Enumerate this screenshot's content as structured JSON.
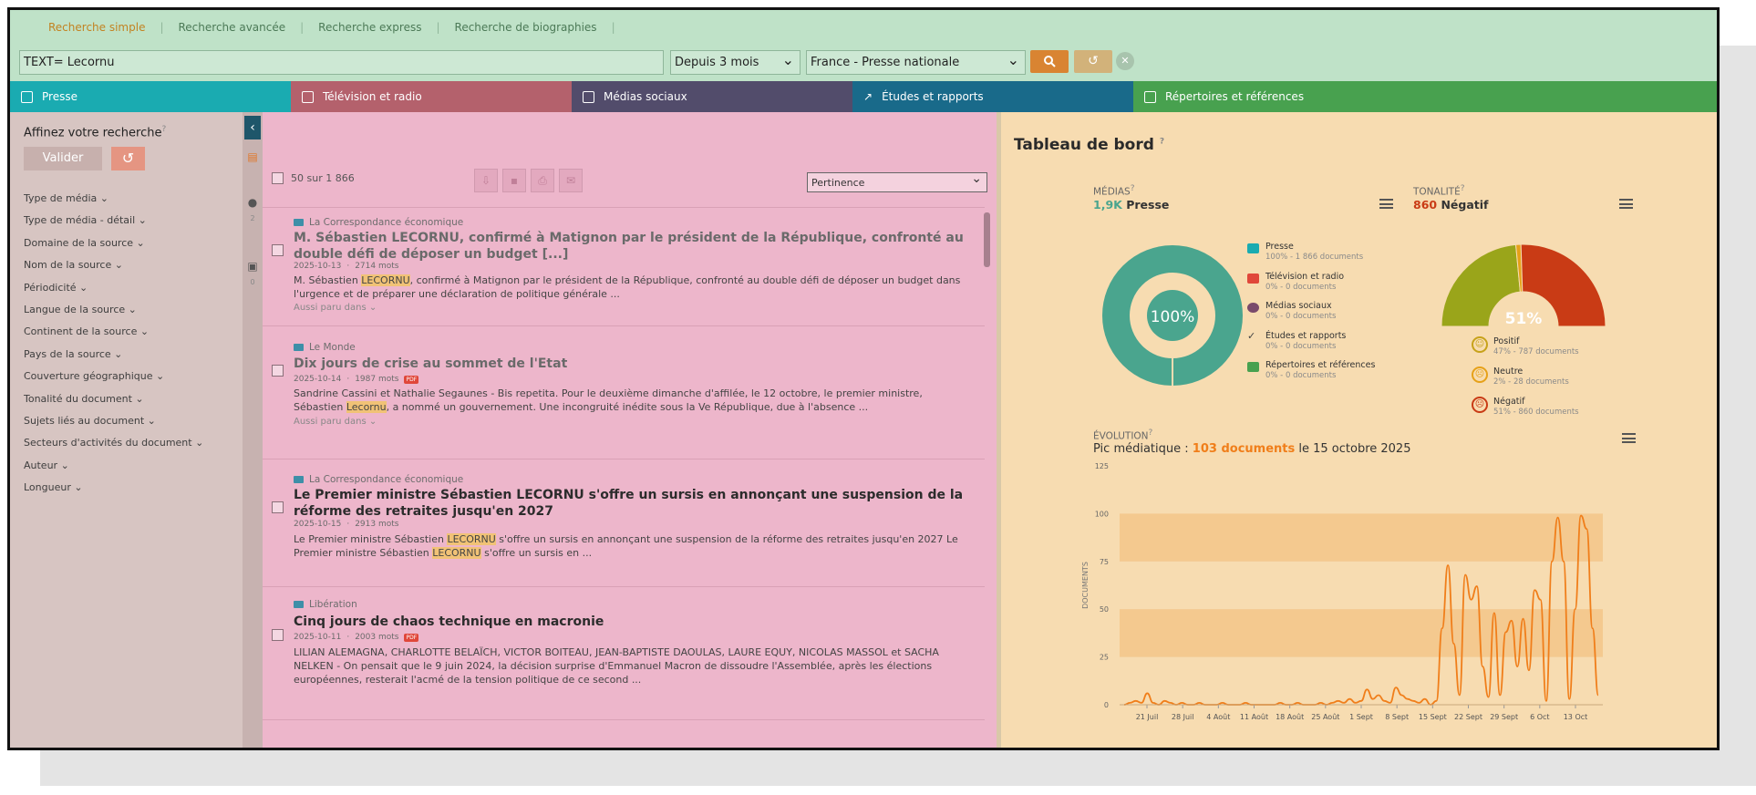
{
  "search_tabs": [
    "Recherche simple",
    "Recherche avancée",
    "Recherche express",
    "Recherche de biographies"
  ],
  "search": {
    "query": "TEXT= Lecornu",
    "period": "Depuis 3 mois",
    "scope": "France - Presse nationale"
  },
  "media_bar": [
    {
      "label": "Presse",
      "color": "#1aabb1"
    },
    {
      "label": "Télévision et radio",
      "color": "#b4616c"
    },
    {
      "label": "Médias sociaux",
      "color": "#524c6b"
    },
    {
      "label": "Études et rapports",
      "color": "#196a8a"
    },
    {
      "label": "Répertoires et références",
      "color": "#48a14f"
    }
  ],
  "sidebar": {
    "title": "Affinez votre recherche",
    "validate_label": "Valider",
    "facets": [
      "Type de média",
      "Type de média - détail",
      "Domaine de la source",
      "Nom de la source",
      "Périodicité",
      "Langue de la source",
      "Continent de la source",
      "Pays de la source",
      "Couverture géographique",
      "Tonalité du document",
      "Sujets liés au document",
      "Secteurs d'activités du document",
      "Auteur",
      "Longueur"
    ],
    "strip_counts": [
      "2",
      "0"
    ]
  },
  "results": {
    "count": "50 sur 1 866",
    "sort": "Pertinence",
    "also_label": "Aussi paru dans",
    "articles": [
      {
        "source": "La Correspondance économique",
        "title": "M. Sébastien LECORNU, confirmé à Matignon par le président de la République, confronté au double défi de déposer un budget [...]",
        "date": "2025-10-13",
        "words": "2714 mots",
        "pdf": false,
        "body_pre": "M. Sébastien ",
        "body_hl": "LECORNU",
        "body_post": ", confirmé à Matignon par le président de la République, confronté au double défi de déposer un budget dans l'urgence et de préparer une déclaration de politique générale ..."
      },
      {
        "source": "Le Monde",
        "title": "Dix jours de crise au sommet de l'Etat",
        "date": "2025-10-14",
        "words": "1987 mots",
        "pdf": true,
        "pdf_label": "PDF",
        "body_pre": "Sandrine Cassini et Nathalie Segaunes - Bis repetita. Pour le deuxième dimanche d'affilée, le 12 octobre, le premier ministre, Sébastien ",
        "body_hl": "Lecornu",
        "body_post": ", a nommé un gouvernement. Une incongruité inédite sous la Ve République, due à l'absence ..."
      },
      {
        "source": "La Correspondance économique",
        "title": "Le Premier ministre Sébastien LECORNU s'offre un sursis en annonçant une suspension de la réforme des retraites jusqu'en 2027",
        "date": "2025-10-15",
        "words": "2913 mots",
        "pdf": false,
        "body_pre": "Le Premier ministre Sébastien ",
        "body_hl": "LECORNU",
        "body_mid": " s'offre un sursis en annonçant une suspension de la réforme des retraites jusqu'en 2027 Le Premier ministre Sébastien ",
        "body_hl2": "LECORNU",
        "body_post": " s'offre un sursis en ..."
      },
      {
        "source": "Libération",
        "title": "Cinq jours de chaos technique en macronie",
        "date": "2025-10-11",
        "words": "2003 mots",
        "pdf": true,
        "pdf_label": "PDF",
        "body_pre": "LILIAN ALEMAGNA, CHARLOTTE BELAÏCH, VICTOR BOITEAU, JEAN-BAPTISTE DAOULAS, LAURE EQUY, NICOLAS MASSOL et SACHA NELKEN - On pensait que le 9 juin 2024, la décision surprise d'Emmanuel Macron de dissoudre l'Assemblée, après les élections européennes, resterait l'acmé de la tension politique de ce second ..."
      }
    ]
  },
  "dashboard": {
    "title": "Tableau de bord",
    "medias": {
      "label": "MÉDIAS",
      "kpi_value": "1,9K",
      "kpi_label": "Presse",
      "center": "100%",
      "legend": [
        {
          "name": "Presse",
          "detail": "100% - 1 866 documents",
          "color": "#1aabb1"
        },
        {
          "name": "Télévision et radio",
          "detail": "0% - 0 documents",
          "color": "#e0473a"
        },
        {
          "name": "Médias sociaux",
          "detail": "0% - 0 documents",
          "color": "#7a4a6b"
        },
        {
          "name": "Études et rapports",
          "detail": "0% - 0 documents",
          "color": "#555"
        },
        {
          "name": "Répertoires et références",
          "detail": "0% - 0 documents",
          "color": "#48a14f"
        }
      ]
    },
    "tonalite": {
      "label": "TONALITÉ",
      "kpi_value": "860",
      "kpi_label": "Négatif",
      "center": "51%",
      "shares": {
        "positif": 47,
        "neutre": 2,
        "negatif": 51
      },
      "legend": [
        {
          "name": "Positif",
          "detail": "47% - 787 documents",
          "color": "#9aa51a",
          "face": "☺"
        },
        {
          "name": "Neutre",
          "detail": "2% - 28 documents",
          "color": "#e6a118",
          "face": "☹"
        },
        {
          "name": "Négatif",
          "detail": "51% - 860 documents",
          "color": "#c93b15",
          "face": "☹"
        }
      ]
    },
    "evolution": {
      "label": "ÉVOLUTION",
      "peak_prefix": "Pic médiatique :",
      "peak_value": "103 documents",
      "peak_suffix": "le 15 octobre 2025"
    }
  },
  "chart_data": {
    "type": "line",
    "ylabel": "DOCUMENTS",
    "ylim": [
      0,
      125
    ],
    "yticks": [
      0,
      25,
      50,
      75,
      100,
      125
    ],
    "xticks": [
      "21 Juil",
      "28 Juil",
      "4 Août",
      "11 Août",
      "18 Août",
      "25 Août",
      "1 Sept",
      "8 Sept",
      "15 Sept",
      "22 Sept",
      "29 Sept",
      "6 Oct",
      "13 Oct"
    ],
    "series": [
      {
        "color": "#f07e1a",
        "values": [
          0,
          1,
          2,
          1,
          6,
          1,
          0,
          2,
          1,
          0,
          1,
          0,
          0,
          1,
          0,
          0,
          0,
          1,
          0,
          0,
          0,
          1,
          0,
          0,
          0,
          0,
          0,
          1,
          0,
          0,
          1,
          0,
          0,
          0,
          1,
          0,
          1,
          2,
          1,
          3,
          1,
          2,
          8,
          3,
          5,
          2,
          1,
          9,
          5,
          3,
          2,
          1,
          3,
          0,
          2,
          40,
          73,
          32,
          5,
          68,
          55,
          62,
          20,
          4,
          48,
          5,
          38,
          44,
          20,
          45,
          18,
          60,
          55,
          2,
          75,
          98,
          75,
          3,
          50,
          99,
          92,
          40,
          5
        ]
      }
    ]
  }
}
